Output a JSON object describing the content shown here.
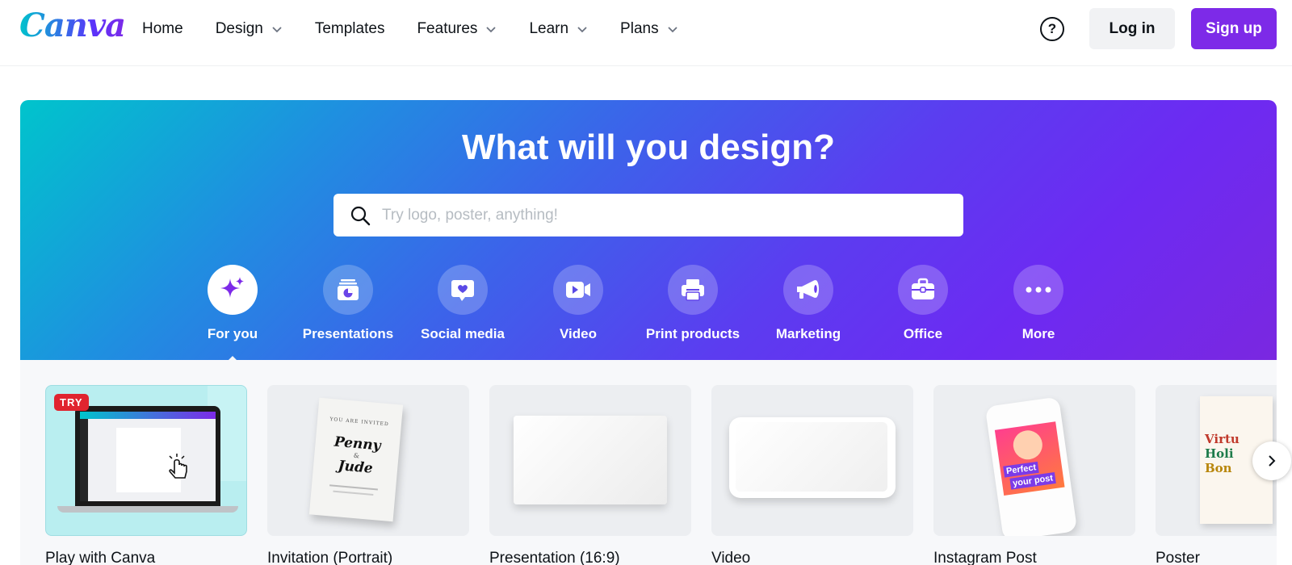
{
  "header": {
    "logo_text": "Canva",
    "nav": [
      {
        "label": "Home",
        "has_dropdown": false
      },
      {
        "label": "Design",
        "has_dropdown": true
      },
      {
        "label": "Templates",
        "has_dropdown": false
      },
      {
        "label": "Features",
        "has_dropdown": true
      },
      {
        "label": "Learn",
        "has_dropdown": true
      },
      {
        "label": "Plans",
        "has_dropdown": true
      }
    ],
    "help_label": "?",
    "login_label": "Log in",
    "signup_label": "Sign up"
  },
  "hero": {
    "title": "What will you design?",
    "search_placeholder": "Try logo, poster, anything!",
    "search_value": "",
    "categories": [
      {
        "label": "For you",
        "icon": "sparkle-icon",
        "active": true
      },
      {
        "label": "Presentations",
        "icon": "presentation-icon",
        "active": false
      },
      {
        "label": "Social media",
        "icon": "heart-bubble-icon",
        "active": false
      },
      {
        "label": "Video",
        "icon": "video-camera-icon",
        "active": false
      },
      {
        "label": "Print products",
        "icon": "printer-icon",
        "active": false
      },
      {
        "label": "Marketing",
        "icon": "megaphone-icon",
        "active": false
      },
      {
        "label": "Office",
        "icon": "briefcase-icon",
        "active": false
      },
      {
        "label": "More",
        "icon": "more-dots-icon",
        "active": false
      }
    ]
  },
  "cards": [
    {
      "title": "Play with Canva",
      "badge": "TRY"
    },
    {
      "title": "Invitation (Portrait)",
      "thumb_text": [
        "YOU ARE INVITED",
        "Penny",
        "& ",
        "Jude"
      ]
    },
    {
      "title": "Presentation (16:9)"
    },
    {
      "title": "Video"
    },
    {
      "title": "Instagram Post",
      "thumb_text": [
        "Perfect",
        "your post"
      ]
    },
    {
      "title": "Poster",
      "thumb_text": [
        "Virtu",
        "Holi",
        "Bon"
      ]
    }
  ],
  "colors": {
    "brand_purple": "#7d2ae8",
    "teal": "#00c4cc"
  }
}
